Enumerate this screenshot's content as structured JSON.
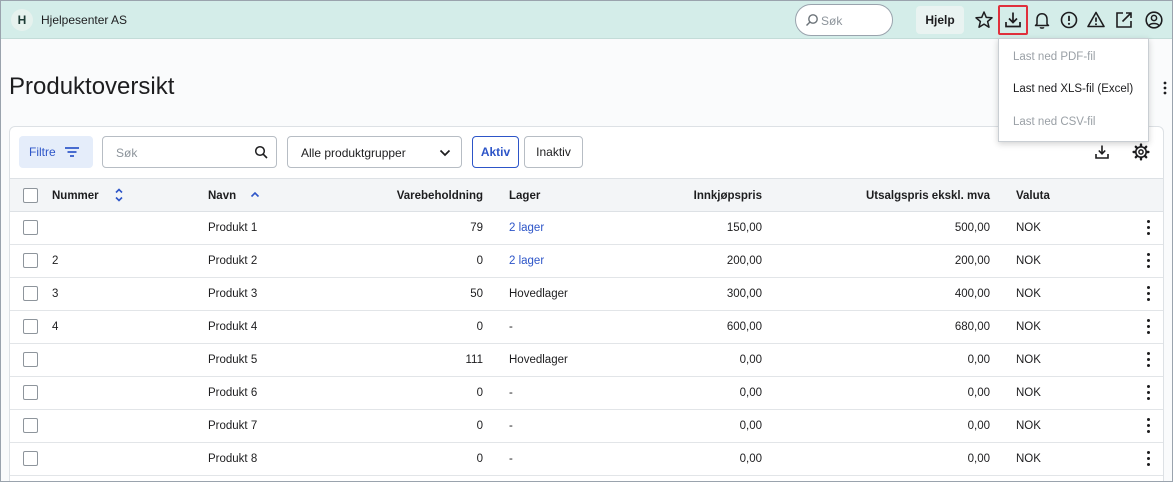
{
  "header": {
    "avatar_letter": "H",
    "company": "Hjelpesenter AS",
    "search_placeholder": "Søk",
    "help_label": "Hjelp",
    "icons": [
      "star-icon",
      "download-icon",
      "bell-icon",
      "alert-circle-icon",
      "warning-icon",
      "open-external-icon",
      "user-circle-icon"
    ]
  },
  "download_menu": {
    "items": [
      {
        "label": "Last ned PDF-fil",
        "enabled": false
      },
      {
        "label": "Last ned XLS-fil (Excel)",
        "enabled": true
      },
      {
        "label": "Last ned CSV-fil",
        "enabled": false
      }
    ]
  },
  "page": {
    "title": "Produktoversikt"
  },
  "toolbar": {
    "filter_label": "Filtre",
    "search_placeholder": "Søk",
    "group_select_value": "Alle produktgrupper",
    "tab_active": "Aktiv",
    "tab_inactive": "Inaktiv"
  },
  "table": {
    "columns": {
      "number": "Nummer",
      "name": "Navn",
      "stock": "Varebeholdning",
      "warehouse": "Lager",
      "purchase_price": "Innkjøpspris",
      "sales_price": "Utsalgspris ekskl. mva",
      "currency": "Valuta"
    },
    "rows": [
      {
        "number": "",
        "name": "Produkt 1",
        "stock": "79",
        "warehouse": "2 lager",
        "warehouse_link": true,
        "purchase_price": "150,00",
        "sales_price": "500,00",
        "currency": "NOK"
      },
      {
        "number": "2",
        "name": "Produkt 2",
        "stock": "0",
        "warehouse": "2 lager",
        "warehouse_link": true,
        "purchase_price": "200,00",
        "sales_price": "200,00",
        "currency": "NOK"
      },
      {
        "number": "3",
        "name": "Produkt 3",
        "stock": "50",
        "warehouse": "Hovedlager",
        "warehouse_link": false,
        "purchase_price": "300,00",
        "sales_price": "400,00",
        "currency": "NOK"
      },
      {
        "number": "4",
        "name": "Produkt 4",
        "stock": "0",
        "warehouse": "-",
        "warehouse_link": false,
        "purchase_price": "600,00",
        "sales_price": "680,00",
        "currency": "NOK"
      },
      {
        "number": "",
        "name": "Produkt 5",
        "stock": "111",
        "warehouse": "Hovedlager",
        "warehouse_link": false,
        "purchase_price": "0,00",
        "sales_price": "0,00",
        "currency": "NOK"
      },
      {
        "number": "",
        "name": "Produkt 6",
        "stock": "0",
        "warehouse": "-",
        "warehouse_link": false,
        "purchase_price": "0,00",
        "sales_price": "0,00",
        "currency": "NOK"
      },
      {
        "number": "",
        "name": "Produkt 7",
        "stock": "0",
        "warehouse": "-",
        "warehouse_link": false,
        "purchase_price": "0,00",
        "sales_price": "0,00",
        "currency": "NOK"
      },
      {
        "number": "",
        "name": "Produkt 8",
        "stock": "0",
        "warehouse": "-",
        "warehouse_link": false,
        "purchase_price": "0,00",
        "sales_price": "0,00",
        "currency": "NOK"
      }
    ]
  },
  "colors": {
    "topbar": "#d4ede9",
    "accent": "#2d55c8",
    "highlight": "#e0303c"
  }
}
